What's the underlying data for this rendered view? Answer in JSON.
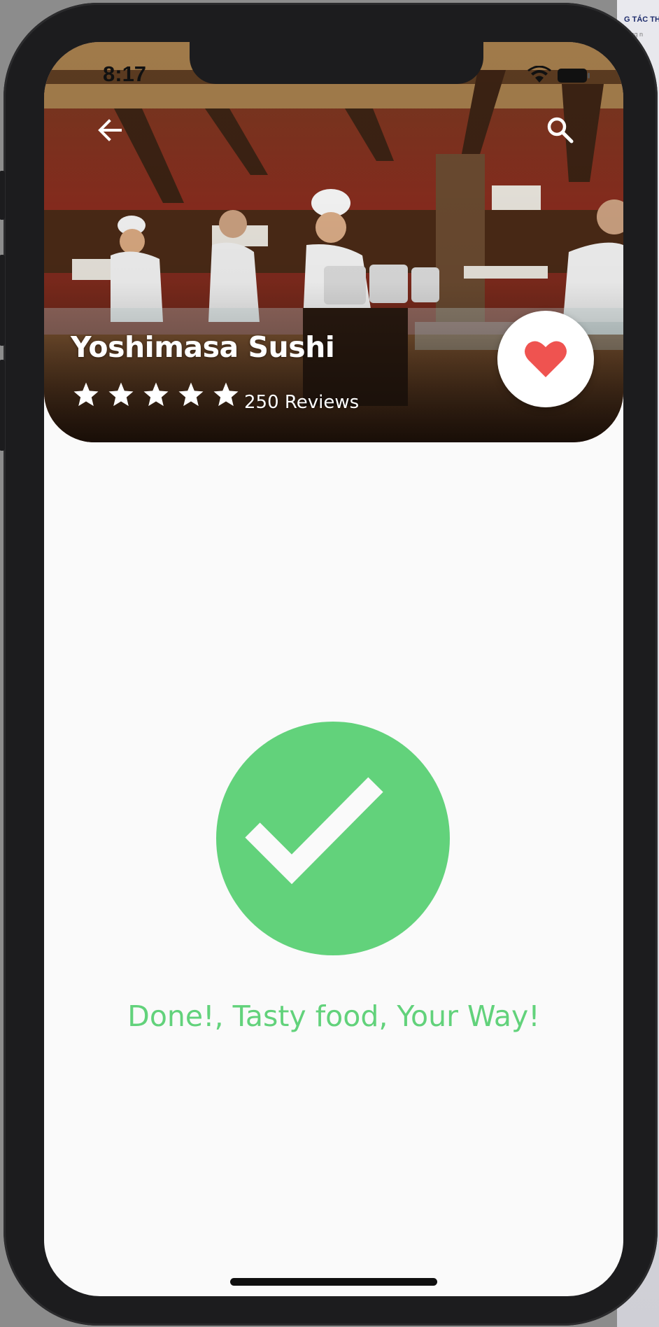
{
  "status_bar": {
    "time": "8:17"
  },
  "restaurant": {
    "name": "Yoshimasa Sushi",
    "rating": 5,
    "rating_max": 5,
    "reviews": "250 Reviews",
    "favorited": true
  },
  "icons": {
    "back": "arrow-left-icon",
    "search": "search-icon",
    "favorite": "heart-icon",
    "success": "check-circle-icon"
  },
  "confirmation": {
    "message": "Done!, Tasty food, Your Way!"
  },
  "colors": {
    "success_green": "#62d27b",
    "heart_red": "#ef5350",
    "device_frame": "#1c1c1e",
    "screen_bg": "#fafafa"
  }
}
